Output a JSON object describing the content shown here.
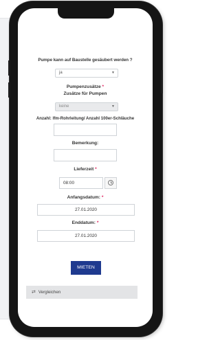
{
  "form": {
    "clean_question": "Pumpe kann auf Baustelle gesäubert werden ?",
    "clean_value": "ja",
    "pump_accessories_label": "Pumpenzusätze",
    "pump_accessories_sub": "Zusätze für Pumpen",
    "pump_accessories_value": "keine",
    "quantity_label": "Anzahl: lfm-Rohrleitung/ Anzahl 100er-Schläuche",
    "quantity_value": "",
    "remark_label": "Bemerkung:",
    "remark_value": "",
    "delivery_time_label": "Lieferzeit",
    "delivery_time_value": "08:00",
    "start_date_label": "Anfangsdatum:",
    "start_date_value": "27.01.2020",
    "end_date_label": "Enddatum:",
    "end_date_value": "27.01.2020",
    "required_marker": "*"
  },
  "actions": {
    "rent_label": "MIETEN",
    "compare_label": "Vergleichen"
  },
  "icons": {
    "caret": "chevron-down-icon",
    "clock": "clock-icon",
    "compare": "compare-icon"
  },
  "colors": {
    "primary": "#1f3a8f",
    "required": "#e0245e",
    "phone_frame": "#151515"
  }
}
